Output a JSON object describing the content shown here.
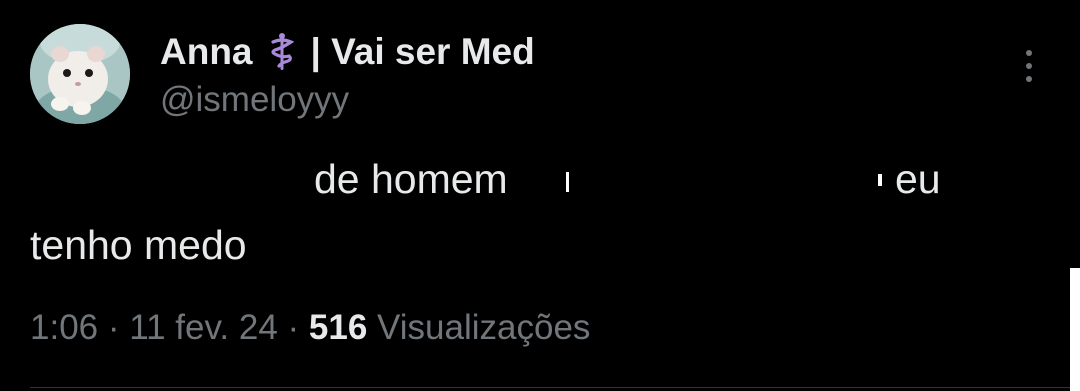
{
  "author": {
    "name": "Anna",
    "badge_emoji": "⚕️",
    "tagline": "| Vai ser Med",
    "handle": "@ismeloyyy",
    "avatar": "hamster-avatar"
  },
  "menu_icon": "more-vertical-icon",
  "tweet": {
    "line1_a": "de homem",
    "line1_b": "eu",
    "line2": "tenho medo",
    "redacted": true
  },
  "meta": {
    "time": "1:06",
    "sep1": "·",
    "date": "11 fev. 24",
    "sep2": "·",
    "views_count": "516",
    "views_label": "Visualizações"
  },
  "colors": {
    "background": "#000000",
    "text": "#e7e9ea",
    "secondary": "#71767b",
    "badge": "#a98ad8"
  }
}
